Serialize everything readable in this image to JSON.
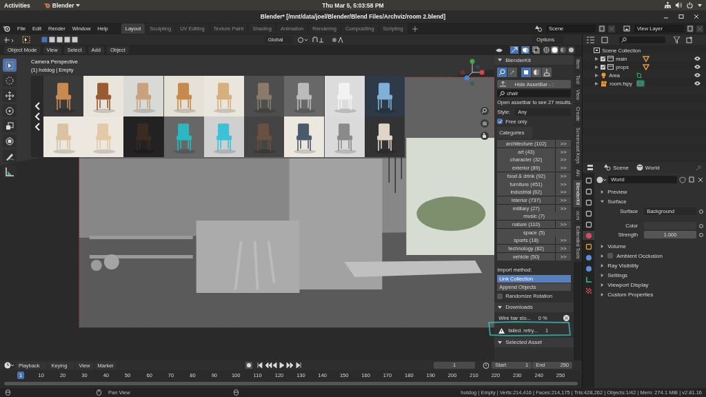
{
  "system_bar": {
    "activities": "Activities",
    "app": "Blender",
    "clock": "Thu Mar 5, 5:03:58 PM"
  },
  "window": {
    "title": "Blender* [/mnt/data/joel/Blender/Blend Files/Archviz/room 2.blend]"
  },
  "menu": [
    "File",
    "Edit",
    "Render",
    "Window",
    "Help"
  ],
  "workspaces": [
    {
      "label": "Layout",
      "selected": true
    },
    {
      "label": "Sculpting",
      "selected": false
    },
    {
      "label": "UV Editing",
      "selected": false
    },
    {
      "label": "Texture Paint",
      "selected": false
    },
    {
      "label": "Shading",
      "selected": false
    },
    {
      "label": "Animation",
      "selected": false
    },
    {
      "label": "Rendering",
      "selected": false
    },
    {
      "label": "Compositing",
      "selected": false
    },
    {
      "label": "Scripting",
      "selected": false
    }
  ],
  "scene": {
    "value": "Scene"
  },
  "view_layer": {
    "value": "View Layer"
  },
  "tool_header": {
    "orientation": "Global",
    "options": "Options"
  },
  "viewport_header": {
    "mode": "Object Mode",
    "menus": [
      "View",
      "Select",
      "Add",
      "Object"
    ],
    "shading_modes": [
      {
        "kind": "wireframe",
        "selected": false
      },
      {
        "kind": "solid",
        "selected": true
      },
      {
        "kind": "material",
        "selected": false
      },
      {
        "kind": "rendered",
        "selected": false
      }
    ]
  },
  "tools": [
    {
      "kind": "select",
      "selected": true
    },
    {
      "kind": "cursor",
      "selected": false
    },
    {
      "kind": "move",
      "selected": false
    },
    {
      "kind": "rotate",
      "selected": false
    },
    {
      "kind": "scale",
      "selected": false
    },
    {
      "kind": "transform",
      "selected": false
    },
    {
      "kind": "annotate",
      "selected": false
    },
    {
      "kind": "measure",
      "selected": false
    }
  ],
  "viewport": {
    "camera": "Camera Perspective",
    "object": "(1) hotdog | Empty"
  },
  "sidebar": {
    "title": "BlenderKit",
    "expanded": true,
    "hide_button": "Hide AssetBar - :",
    "search": {
      "value": "chair"
    },
    "results": "Open assetbar to see 27 results.",
    "style": {
      "label": "Style:",
      "value": "Any"
    },
    "free_only": {
      "label": "Free only",
      "checked": true
    },
    "categories_label": "Categories",
    "categories": [
      {
        "name": "architecture (102)",
        "more": ">>"
      },
      {
        "name": "art (43)",
        "more": ">>"
      },
      {
        "name": "character (32)",
        "more": ">>"
      },
      {
        "name": "exterior (89)",
        "more": ">>"
      },
      {
        "name": "food & drink (92)",
        "more": ">>"
      },
      {
        "name": "furniture (451)",
        "more": ">>"
      },
      {
        "name": "industrial (62)",
        "more": ">>"
      },
      {
        "name": "interior (737)",
        "more": ">>"
      },
      {
        "name": "military (27)",
        "more": ">>"
      },
      {
        "name": "music (7)"
      },
      {
        "name": "nature (110)",
        "more": ">>"
      },
      {
        "name": "space (5)"
      },
      {
        "name": "sports (18)",
        "more": ">>"
      },
      {
        "name": "technology (82)",
        "more": ">>"
      },
      {
        "name": "vehicle (50)",
        "more": ">>"
      }
    ],
    "import_label": "Import method:",
    "import_methods": [
      {
        "label": "Link Collection",
        "selected": true
      },
      {
        "label": "Append Objects",
        "selected": false
      }
    ],
    "randomize": {
      "label": "Randomize Rotation",
      "checked": false
    },
    "downloads": {
      "title": "Downloads",
      "expanded": true,
      "items": [
        {
          "kind": "progress",
          "name": "Wire bar sto...",
          "value": "0 %"
        },
        {
          "kind": "warning",
          "name": "failed. retry...",
          "value": "1"
        }
      ]
    },
    "selected_asset": {
      "title": "Selected Asset",
      "expanded": true
    },
    "tabs": [
      {
        "label": "Item",
        "selected": false
      },
      {
        "label": "Tool",
        "selected": false
      },
      {
        "label": "View",
        "selected": false
      },
      {
        "label": "Create",
        "selected": false
      },
      {
        "label": "Screencast Keys",
        "selected": false
      },
      {
        "label": "AN",
        "selected": false
      },
      {
        "label": "BlenderKit",
        "selected": true
      },
      {
        "label": "ocm",
        "selected": false
      },
      {
        "label": "Extended Tools",
        "selected": false
      }
    ]
  },
  "outliner": {
    "items": [
      {
        "label": "Scene Collection",
        "children": [
          {
            "label": "main",
            "kind": "collection",
            "checked": true
          },
          {
            "label": "props",
            "kind": "collection",
            "checked": true
          },
          {
            "label": "Area",
            "kind": "light"
          },
          {
            "label": "room.fspy",
            "kind": "camera"
          }
        ]
      }
    ]
  },
  "properties": {
    "scene": "Scene",
    "world": "World",
    "world_name": "World",
    "tabs": [
      {
        "kind": "tool",
        "selected": false
      },
      {
        "kind": "render",
        "selected": false
      },
      {
        "kind": "output",
        "selected": false
      },
      {
        "kind": "view_layer",
        "selected": false
      },
      {
        "kind": "scene",
        "selected": false
      },
      {
        "kind": "world",
        "selected": true
      },
      {
        "kind": "object",
        "selected": false
      },
      {
        "kind": "physics",
        "selected": false
      },
      {
        "kind": "constraints",
        "selected": false
      },
      {
        "kind": "data",
        "selected": false
      },
      {
        "kind": "texture",
        "selected": false
      }
    ],
    "panels": [
      {
        "label": "Preview",
        "expanded": false
      },
      {
        "label": "Surface",
        "expanded": true,
        "fields": [
          {
            "kind": "dropdown",
            "label": "Surface",
            "value": "Background"
          },
          {
            "kind": "color",
            "label": "Color"
          },
          {
            "kind": "number",
            "label": "Strength",
            "value": "1.000"
          }
        ]
      },
      {
        "label": "Volume",
        "expanded": false
      },
      {
        "label": "Ambient Occlusion",
        "expanded": false,
        "checked": false
      },
      {
        "label": "Ray Visibility",
        "expanded": false
      },
      {
        "label": "Settings",
        "expanded": false
      },
      {
        "label": "Viewport Display",
        "expanded": false
      },
      {
        "label": "Custom Properties",
        "expanded": false
      }
    ]
  },
  "timeline": {
    "menus": [
      {
        "label": "Playback",
        "kind": "dropdown"
      },
      {
        "label": "Keying",
        "kind": "dropdown"
      },
      {
        "label": "View",
        "kind": "plain"
      },
      {
        "label": "Marker",
        "kind": "plain"
      }
    ],
    "current_frame": "1",
    "start": {
      "label": "Start",
      "value": "1"
    },
    "end": {
      "label": "End",
      "value": "250"
    },
    "ruler": [
      {
        "label": "1",
        "selected": true
      },
      {
        "label": "10",
        "selected": false
      },
      {
        "label": "20",
        "selected": false
      },
      {
        "label": "30",
        "selected": false
      },
      {
        "label": "40",
        "selected": false
      },
      {
        "label": "50",
        "selected": false
      },
      {
        "label": "60",
        "selected": false
      },
      {
        "label": "70",
        "selected": false
      },
      {
        "label": "80",
        "selected": false
      },
      {
        "label": "90",
        "selected": false
      },
      {
        "label": "100",
        "selected": false
      },
      {
        "label": "110",
        "selected": false
      },
      {
        "label": "120",
        "selected": false
      },
      {
        "label": "130",
        "selected": false
      },
      {
        "label": "140",
        "selected": false
      },
      {
        "label": "150",
        "selected": false
      },
      {
        "label": "160",
        "selected": false
      },
      {
        "label": "170",
        "selected": false
      },
      {
        "label": "180",
        "selected": false
      },
      {
        "label": "190",
        "selected": false
      },
      {
        "label": "200",
        "selected": false
      },
      {
        "label": "210",
        "selected": false
      },
      {
        "label": "220",
        "selected": false
      },
      {
        "label": "230",
        "selected": false
      },
      {
        "label": "240",
        "selected": false
      },
      {
        "label": "250",
        "selected": false
      }
    ]
  },
  "status_bar": {
    "hint": "Pan View",
    "stats": "hotdog | Empty | Verts:214,416 | Faces:214,175 | Tris:428,262 | Objects:1/42 | Mem: 274.1 MiB | v2.81.16"
  }
}
